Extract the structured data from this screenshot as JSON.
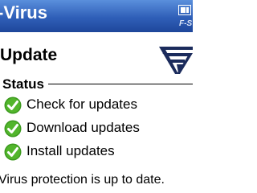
{
  "titlebar": {
    "title": "-Virus",
    "brand": "F-S",
    "battery_icon": "battery-icon"
  },
  "header": {
    "title": "Update",
    "logo_icon": "f-secure-logo-icon"
  },
  "status_section": {
    "label": "Status",
    "steps": [
      {
        "label": "Check for updates",
        "icon": "check-icon"
      },
      {
        "label": "Download updates",
        "icon": "check-icon"
      },
      {
        "label": "Install updates",
        "icon": "check-icon"
      }
    ]
  },
  "message": "Virus protection is up to date.",
  "colors": {
    "titlebar": "#2f5fb8",
    "check_green": "#3c9a1e",
    "logo": "#1b2b5c"
  }
}
